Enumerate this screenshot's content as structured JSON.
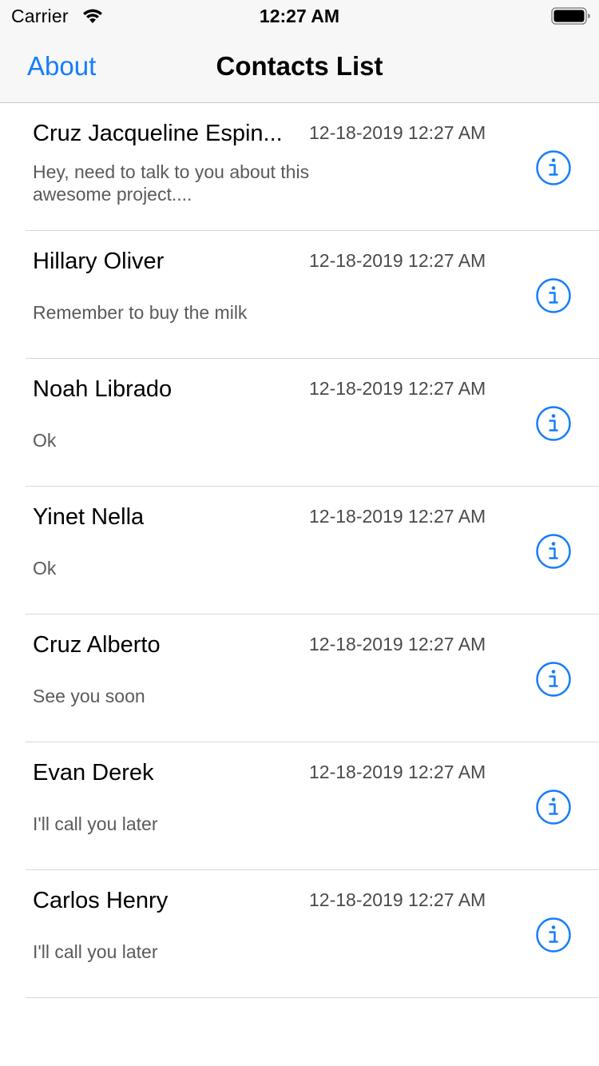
{
  "status_bar": {
    "carrier": "Carrier",
    "time": "12:27 AM",
    "wifi_icon": "wifi-icon",
    "battery_icon": "battery-icon"
  },
  "nav": {
    "left_button": "About",
    "title": "Contacts List"
  },
  "accent_color": "#147efb",
  "contacts": [
    {
      "name": "Cruz Jacqueline Espin...",
      "date": "12-18-2019 12:27 AM",
      "message": "Hey, need to talk to you about this awesome project....",
      "icon": "info-icon"
    },
    {
      "name": "Hillary Oliver",
      "date": "12-18-2019 12:27 AM",
      "message": "Remember to buy the milk",
      "icon": "info-icon"
    },
    {
      "name": "Noah Librado",
      "date": "12-18-2019 12:27 AM",
      "message": "Ok",
      "icon": "info-icon"
    },
    {
      "name": "Yinet Nella",
      "date": "12-18-2019 12:27 AM",
      "message": "Ok",
      "icon": "info-icon"
    },
    {
      "name": "Cruz Alberto",
      "date": "12-18-2019 12:27 AM",
      "message": "See you soon",
      "icon": "info-icon"
    },
    {
      "name": "Evan Derek",
      "date": "12-18-2019 12:27 AM",
      "message": "I'll call you later",
      "icon": "info-icon"
    },
    {
      "name": "Carlos Henry",
      "date": "12-18-2019 12:27 AM",
      "message": "I'll call you later",
      "icon": "info-icon"
    }
  ]
}
